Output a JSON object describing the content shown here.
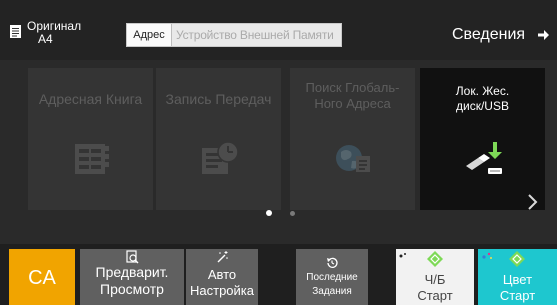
{
  "header": {
    "original_title": "Оригинал",
    "original_size": "A4",
    "address_label": "Адрес",
    "address_value": "Устройство Внешней Памяти",
    "details_label": "Сведения"
  },
  "tiles": [
    {
      "label": "Адресная Книга",
      "icon": "address-book-icon",
      "enabled": false
    },
    {
      "label": "Запись Передач",
      "icon": "transmission-log-icon",
      "enabled": false
    },
    {
      "label": "Поиск Глобаль-\nНого Адреса",
      "icon": "global-address-search-icon",
      "enabled": false
    },
    {
      "label": "Лок. Жес.\nдиск/USB",
      "icon": "usb-drive-icon",
      "enabled": true
    }
  ],
  "pager": {
    "pages": 2,
    "current": 1
  },
  "bottom": {
    "ca_label": "CA",
    "preview_line1": "Предварит.",
    "preview_line2": "Просмотр",
    "auto_line1": "Авто",
    "auto_line2": "Настройка",
    "recent_line1": "Последние",
    "recent_line2": "Задания",
    "bw_line1": "Ч/Б",
    "bw_line2": "Старт",
    "color_line1": "Цвет",
    "color_line2": "Старт"
  },
  "colors": {
    "background": "#222222",
    "ca": "#f1a400",
    "bw_start": "#f2f2f2",
    "color_start": "#1ec7cf",
    "start_diamond": "#7ed957",
    "usb_arrow": "#7ed957"
  }
}
